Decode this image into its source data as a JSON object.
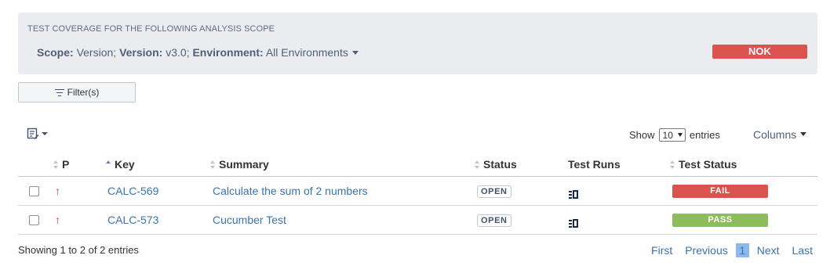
{
  "scope": {
    "heading": "TEST COVERAGE FOR THE FOLLOWING ANALYSIS SCOPE",
    "scope_label": "Scope:",
    "scope_value": "Version;",
    "version_label": "Version:",
    "version_value": "v3.0;",
    "environment_label": "Environment:",
    "environment_value": "All Environments",
    "result_badge": "NOK",
    "result_color": "#d9534f"
  },
  "filter": {
    "label": "Filter(s)",
    "icon": "filter-icon"
  },
  "table_controls": {
    "show_label": "Show",
    "entries_value": "10",
    "entries_label": "entries",
    "columns_label": "Columns",
    "doc_menu_icon": "document-edit-icon"
  },
  "table": {
    "headers": {
      "priority": "P",
      "key": "Key",
      "summary": "Summary",
      "status": "Status",
      "test_runs": "Test Runs",
      "test_status": "Test Status"
    },
    "rows": [
      {
        "priority_icon": "↑",
        "key": "CALC-569",
        "summary": "Calculate the sum of 2 numbers",
        "status": "OPEN",
        "test_status": "FAIL",
        "test_status_color": "#d9534f"
      },
      {
        "priority_icon": "↑",
        "key": "CALC-573",
        "summary": "Cucumber Test",
        "status": "OPEN",
        "test_status": "PASS",
        "test_status_color": "#8dbc5c"
      }
    ]
  },
  "footer": {
    "showing": "Showing 1 to 2 of 2 entries",
    "pager": {
      "first": "First",
      "previous": "Previous",
      "current": "1",
      "next": "Next",
      "last": "Last"
    }
  }
}
